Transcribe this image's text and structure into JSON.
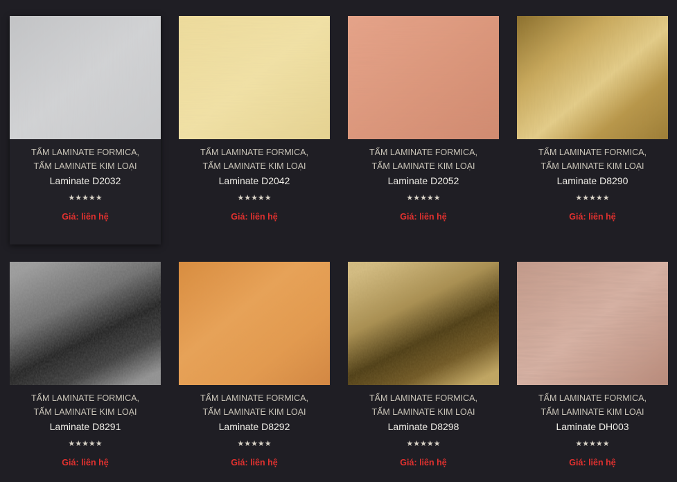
{
  "products": [
    {
      "category_1": "TẤM LAMINATE FORMICA",
      "separator": ", ",
      "category_2": "TẤM LAMINATE KIM LOẠI",
      "name": "Laminate D2032",
      "rating_stars": "★★★★★",
      "price": "Giá: liên hệ",
      "finish": "silver-brushed"
    },
    {
      "category_1": "TẤM LAMINATE FORMICA",
      "separator": ", ",
      "category_2": "TẤM LAMINATE KIM LOẠI",
      "name": "Laminate D2042",
      "rating_stars": "★★★★★",
      "price": "Giá: liên hệ",
      "finish": "pale-gold-brushed"
    },
    {
      "category_1": "TẤM LAMINATE FORMICA",
      "separator": ", ",
      "category_2": "TẤM LAMINATE KIM LOẠI",
      "name": "Laminate D2052",
      "rating_stars": "★★★★★",
      "price": "Giá: liên hệ",
      "finish": "copper-brushed"
    },
    {
      "category_1": "TẤM LAMINATE FORMICA",
      "separator": ", ",
      "category_2": "TẤM LAMINATE KIM LOẠI",
      "name": "Laminate D8290",
      "rating_stars": "★★★★★",
      "price": "Giá: liên hệ",
      "finish": "bronze-gold"
    },
    {
      "category_1": "TẤM LAMINATE FORMICA",
      "separator": ", ",
      "category_2": "TẤM LAMINATE KIM LOẠI",
      "name": "Laminate D8291",
      "rating_stars": "★★★★★",
      "price": "Giá: liên hệ",
      "finish": "black-silver-textured"
    },
    {
      "category_1": "TẤM LAMINATE FORMICA",
      "separator": ", ",
      "category_2": "TẤM LAMINATE KIM LOẠI",
      "name": "Laminate D8292",
      "rating_stars": "★★★★★",
      "price": "Giá: liên hệ",
      "finish": "orange-copper"
    },
    {
      "category_1": "TẤM LAMINATE FORMICA",
      "separator": ", ",
      "category_2": "TẤM LAMINATE KIM LOẠI",
      "name": "Laminate D8298",
      "rating_stars": "★★★★★",
      "price": "Giá: liên hệ",
      "finish": "dark-gold-textured"
    },
    {
      "category_1": "TẤM LAMINATE FORMICA",
      "separator": ", ",
      "category_2": "TẤM LAMINATE KIM LOẠI",
      "name": "Laminate DH003",
      "rating_stars": "★★★★★",
      "price": "Giá: liên hệ",
      "finish": "rose-wave"
    }
  ],
  "colors": {
    "background": "#1f1e24",
    "category_text": "#c9c4b8",
    "title_text": "#f1efe9",
    "price_text": "#e0312f",
    "star": "#d8d2c6"
  }
}
